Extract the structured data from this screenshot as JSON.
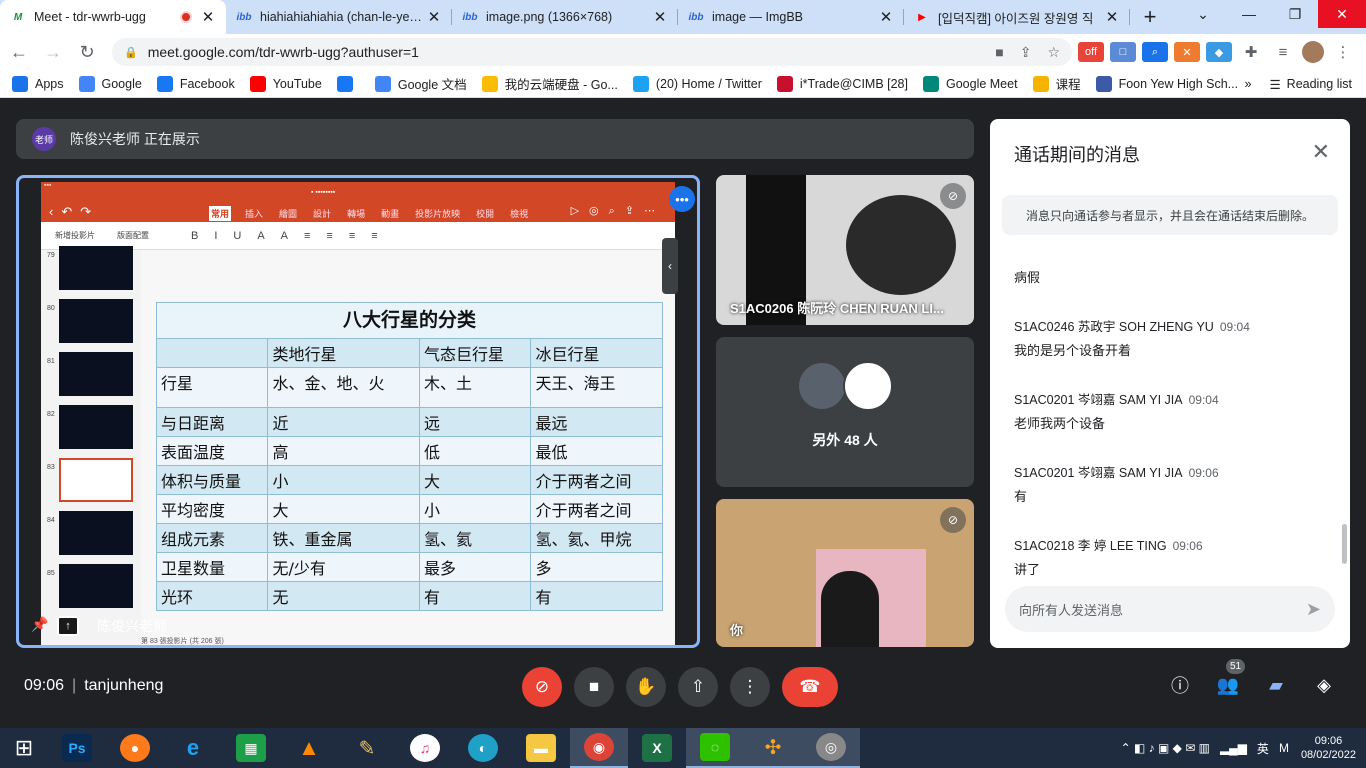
{
  "tabs": [
    {
      "title": "Meet - tdr-wwrb-ugg",
      "fav": "M",
      "favcolor": "#1e8e3e",
      "active": true,
      "recording": true
    },
    {
      "title": "hiahiahiahiahia (chan-le-yee) -",
      "fav": "ibb",
      "favcolor": "#2a62d8"
    },
    {
      "title": "image.png (1366×768)",
      "fav": "ibb",
      "favcolor": "#2a62d8"
    },
    {
      "title": "image — ImgBB",
      "fav": "ibb",
      "favcolor": "#2a62d8"
    },
    {
      "title": "[입덕직캠] 아이즈원 장원영 직",
      "fav": "▶",
      "favcolor": "#ff0000"
    }
  ],
  "address": {
    "url": "meet.google.com/tdr-wwrb-ugg?authuser=1"
  },
  "bookmarks": [
    {
      "label": "Apps",
      "icon": "apps-grid-icon",
      "color": "#1a73e8"
    },
    {
      "label": "Google",
      "icon": "google-icon",
      "color": "#4285f4"
    },
    {
      "label": "Facebook",
      "icon": "facebook-icon",
      "color": "#1877f2"
    },
    {
      "label": "YouTube",
      "icon": "youtube-icon",
      "color": "#ff0000"
    },
    {
      "label": "",
      "icon": "facebook-icon",
      "color": "#1877f2"
    },
    {
      "label": "Google 文档",
      "icon": "docs-icon",
      "color": "#4285f4"
    },
    {
      "label": "我的云端硬盘 - Go...",
      "icon": "drive-icon",
      "color": "#fbbc04"
    },
    {
      "label": "(20) Home / Twitter",
      "icon": "twitter-icon",
      "color": "#1da1f2"
    },
    {
      "label": "i*Trade@CIMB [28]",
      "icon": "cimb-icon",
      "color": "#c8102e"
    },
    {
      "label": "Google Meet",
      "icon": "meet-icon",
      "color": "#00897b"
    },
    {
      "label": "课程",
      "icon": "classroom-icon",
      "color": "#f4b400"
    },
    {
      "label": "Foon Yew High Sch...",
      "icon": "school-icon",
      "color": "#3c5aa6"
    }
  ],
  "bookmarks_more": "»",
  "reading_list": "Reading list",
  "presenting_bar": {
    "avatar": "老师",
    "text": "陈俊兴老师 正在展示"
  },
  "ppt": {
    "menu": [
      "常用",
      "插入",
      "繪圖",
      "設計",
      "轉場",
      "動畫",
      "投影片放映",
      "校閱",
      "檢視"
    ],
    "ribbon": [
      "新增投影片",
      "版面配置"
    ],
    "footer": "第 83 張投影片 (共 206 張)",
    "thumb_numbers": [
      "79",
      "80",
      "81",
      "82",
      "83",
      "84",
      "85"
    ]
  },
  "table": {
    "title": "八大行星的分类",
    "header": [
      "",
      "类地行星",
      "气态巨行星",
      "冰巨行星"
    ],
    "rows": [
      [
        "行星",
        "水、金、地、火",
        "木、土",
        "天王、海王"
      ],
      [
        "与日距离",
        "近",
        "远",
        "最远"
      ],
      [
        "表面温度",
        "高",
        "低",
        "最低"
      ],
      [
        "体积与质量",
        "小",
        "大",
        "介于两者之间"
      ],
      [
        "平均密度",
        "大",
        "小",
        "介于两者之间"
      ],
      [
        "组成元素",
        "铁、重金属",
        "氢、氦",
        "氢、氦、甲烷"
      ],
      [
        "卫星数量",
        "无/少有",
        "最多",
        "多"
      ],
      [
        "光环",
        "无",
        "有",
        "有"
      ]
    ]
  },
  "presenter_label": "陈俊兴老师",
  "tiles": {
    "t1_name": "S1AC0206 陈阮玲 CHEN RUAN LI...",
    "others": "另外 48 人",
    "self": "你"
  },
  "chat": {
    "title": "通话期间的消息",
    "note": "消息只向通话参与者显示，并且会在通话结束后删除。",
    "messages": [
      {
        "who": "",
        "time": "",
        "text": "病假"
      },
      {
        "who": "S1AC0246 苏政宇 SOH ZHENG YU",
        "time": "09:04",
        "text": "我的是另个设备开着"
      },
      {
        "who": "S1AC0201 岑翊嘉 SAM YI JIA",
        "time": "09:04",
        "text": "老师我两个设备"
      },
      {
        "who": "S1AC0201 岑翊嘉 SAM YI JIA",
        "time": "09:06",
        "text": "有"
      },
      {
        "who": "S1AC0218 李 婷 LEE TING",
        "time": "09:06",
        "text": "讲了"
      }
    ],
    "placeholder": "向所有人发送消息"
  },
  "bottom": {
    "time": "09:06",
    "meeting": "tanjunheng",
    "people_count": "51"
  },
  "taskbar": {
    "ime": "英",
    "time": "09:06",
    "date": "08/02/2022"
  }
}
